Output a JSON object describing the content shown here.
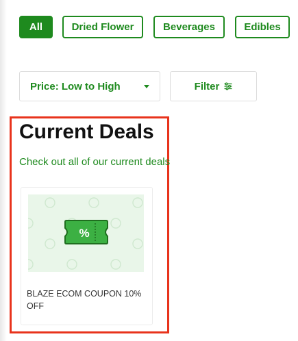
{
  "filters": {
    "chips": [
      {
        "label": "All",
        "active": true
      },
      {
        "label": "Dried Flower",
        "active": false
      },
      {
        "label": "Beverages",
        "active": false
      },
      {
        "label": "Edibles",
        "active": false
      }
    ]
  },
  "sort": {
    "selected": "Price: Low to High"
  },
  "filter_button": {
    "label": "Filter"
  },
  "deals": {
    "title": "Current Deals",
    "subtitle": "Check out all of our current deals",
    "items": [
      {
        "name": "BLAZE ECOM COUPON 10% OFF",
        "badge_symbol": "%"
      }
    ]
  },
  "colors": {
    "accent": "#1e8a1e",
    "highlight": "#e8331c",
    "card_bg": "#e9f6e9",
    "coupon": "#3cb043"
  }
}
